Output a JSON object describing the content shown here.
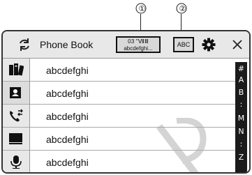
{
  "callouts": [
    "①",
    "②"
  ],
  "header": {
    "title": "Phone Book",
    "device_line1": "03 \"ⅦⅢ",
    "device_line2": "abcdefghi...",
    "sort_label": "ABC"
  },
  "sidebar": {
    "items": [
      {
        "icon": "phonebook-icon"
      },
      {
        "icon": "contact-card-icon",
        "active": true
      },
      {
        "icon": "call-history-icon"
      },
      {
        "icon": "keypad-icon"
      },
      {
        "icon": "voice-microphone-icon"
      }
    ]
  },
  "contacts": [
    "abcdefghi",
    "abcdefghi",
    "abcdefghi",
    "abcdefghi",
    "abcdefghi"
  ],
  "index_letters": [
    "#",
    "A",
    "B",
    ":",
    "M",
    "N",
    ":",
    "Z"
  ],
  "colors": {
    "header_bg": "#e8e8e8",
    "index_bg": "#1b1b1b"
  }
}
